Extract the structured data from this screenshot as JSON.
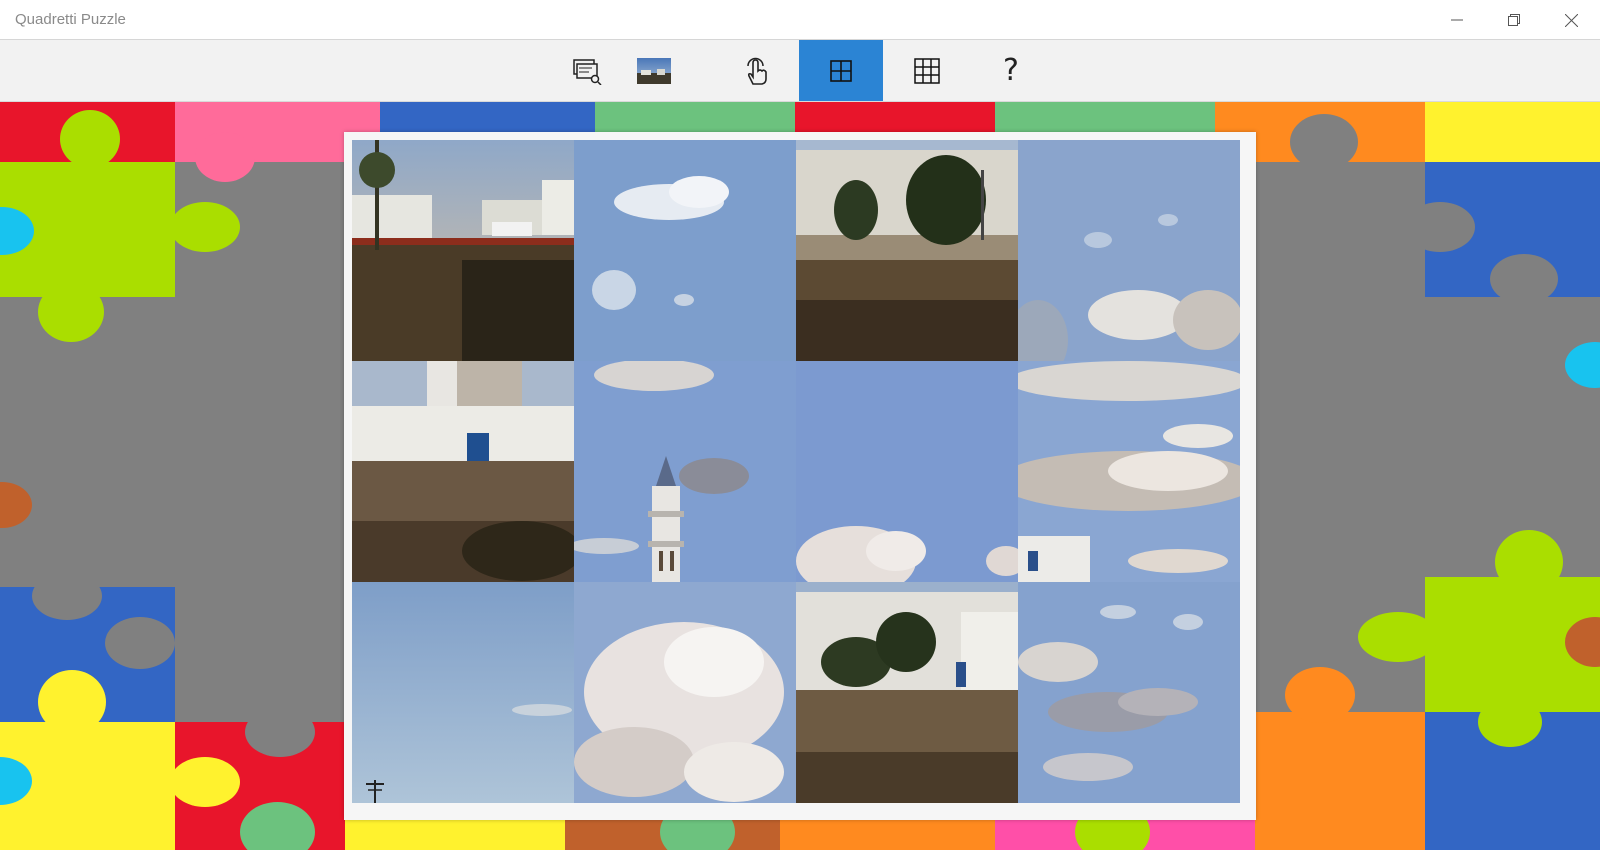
{
  "window": {
    "title": "Quadretti Puzzle",
    "controls": [
      "minimize",
      "restore",
      "close"
    ]
  },
  "toolbar": {
    "buttons": [
      {
        "name": "change-picture-icon"
      },
      {
        "name": "picture-preview-thumbnail"
      },
      {
        "name": "touch-hand-icon"
      },
      {
        "name": "grid-2x2-icon",
        "active": true
      },
      {
        "name": "grid-3x3-icon"
      },
      {
        "name": "help-icon",
        "glyph": "?"
      }
    ],
    "active_color": "#2b84d4"
  },
  "puzzle": {
    "rows": 3,
    "columns": 4,
    "tiles": [
      {
        "content": "houses-palm-ground"
      },
      {
        "content": "sky-cloud"
      },
      {
        "content": "houses-trees-ground"
      },
      {
        "content": "sky-clouds-right"
      },
      {
        "content": "white-building-door"
      },
      {
        "content": "minaret-sky"
      },
      {
        "content": "sky-cloud-low"
      },
      {
        "content": "clouds-building-corner"
      },
      {
        "content": "sky-pole"
      },
      {
        "content": "bright-clouds"
      },
      {
        "content": "white-houses-palms"
      },
      {
        "content": "sky-dark-clouds"
      }
    ]
  },
  "colors": {
    "puzzle_red": "#e8152b",
    "puzzle_pink": "#ff6b9a",
    "puzzle_blue": "#3366c4",
    "puzzle_green": "#6cc27e",
    "puzzle_orange": "#ff8a1f",
    "puzzle_yellow": "#fff22e",
    "puzzle_lime": "#aade00",
    "puzzle_cyan": "#18c3ef",
    "puzzle_brown": "#c0612c",
    "puzzle_gray": "#808080"
  }
}
